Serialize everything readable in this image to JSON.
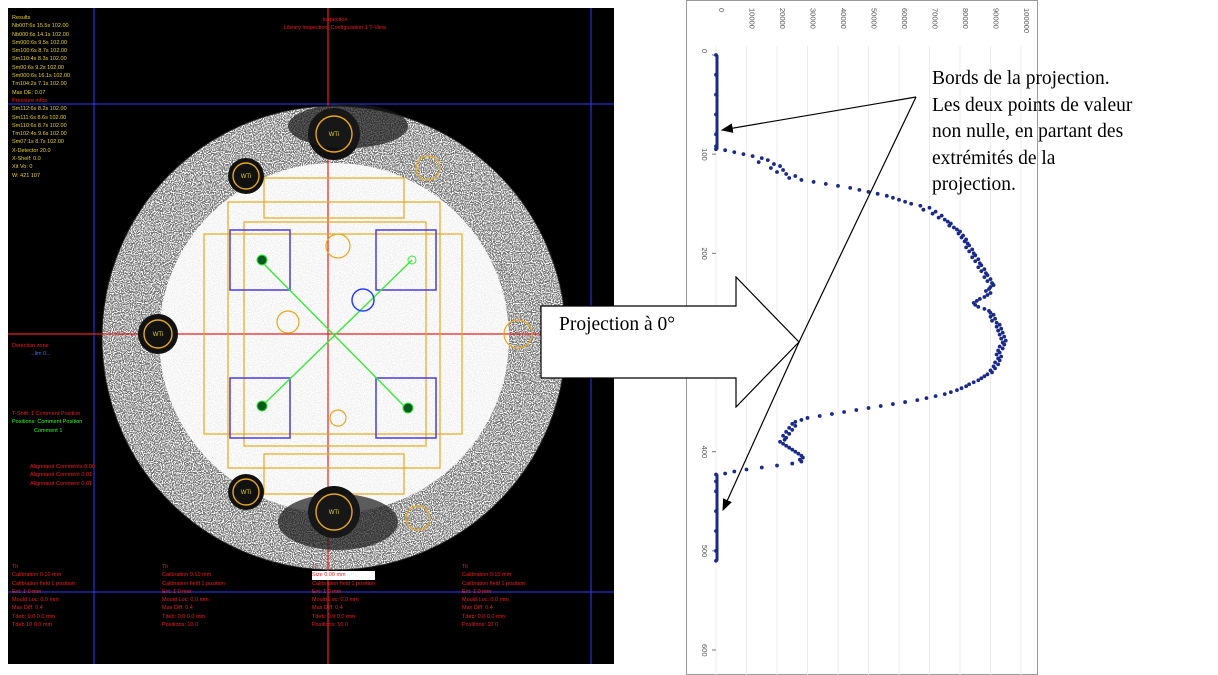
{
  "annotation": {
    "lines": [
      "Bords de la projection.",
      "Les deux points de valeur",
      "non nulle, en partant des",
      "extrémités de la",
      "projection."
    ]
  },
  "projection_label": "Projection à 0°",
  "xray": {
    "overlay_top_left": [
      "Results",
      "Nb00T:6s 15.5s 102.00",
      "Nb000:6s 14.1s 102.00",
      "Sm000:6s 9.5s 102.00",
      "Sm100:6s 8.7s 102.00",
      "Sm110:4s 8.3s 102.00",
      "Sm00:6s 9.2s 102.00",
      "Sm000:6s 16.1s 102.00",
      "Tm104:2s 7.1s 102.00",
      "Max DE: 0.07",
      "Pressure infos",
      "Sm112:6s 8.2s 102.00",
      "Sm111:6s 8.6s 102.00",
      "Sm110:6s 8.7s 102.00",
      "Tm102:4s 9.6s 102.00",
      "Sm07:1s 8.7s 102.00",
      "X-Detector 20.0",
      "X-Shelf: 0.0",
      "Xit Vo: 0",
      "W: 421 107"
    ],
    "overlay_top_center": [
      "Inspection",
      "Library Inspection_Configuration 1 T-View"
    ],
    "overlay_left_mid": [
      "Detection zone",
      "...lim 0..."
    ],
    "legend": [
      "T-Shift: 1 Comment Position",
      "Positions: Comment Position",
      "Comment 1"
    ],
    "status": [
      "Alignment Comments 0.00",
      "Alignment Comment 0.01",
      "Alignment Comment 0.01"
    ],
    "bottom_columns": [
      [
        "Tit",
        "Calibration 0.10 mm",
        "Calibration field 1 position",
        "Ext: 1 0 mm",
        "Mould Loc: 0.0 mm",
        "Max Diff: 0.4",
        "Tdeb: 0.0 0.0 mm",
        "Tdeb 10 0.0 mm"
      ],
      [
        "Tit",
        "Calibration 0.10 mm",
        "Calibration field 1 position",
        "Ext: 1 0 mm",
        "Mould Loc: 0.0 mm",
        "Max Diff: 0.4",
        "Tdeb: 0.0 0.0 mm",
        "Positions: 10 0"
      ],
      [
        "Tit",
        "Size 0.00 mm",
        "Calibration field 1 position",
        "Ext: 1 0 mm",
        "Mould Loc: 0.0 mm",
        "Max Diff: 0.4",
        "Tdeb: 0.0 0.0 mm",
        "Positions: 10 0"
      ],
      [
        "Tit",
        "Calibration 0.10 mm",
        "Calibration field 1 position",
        "Ext: 1 0 mm",
        "Mould Loc: 0.0 mm",
        "Max Diff: 0.4",
        "Tdeb: 0.0 0.0 mm",
        "Positions: 10 0"
      ]
    ],
    "disc_labels": [
      "WTi",
      "WTi",
      "WTi",
      "WTi",
      "WTi"
    ],
    "colors": {
      "ruler": "#e82020",
      "frame": "#2a3cff",
      "outline": "#e8a81c",
      "cross": "#38e838"
    }
  },
  "chart_data": {
    "type": "scatter",
    "orientation": "rotated-90",
    "x_ticks": [
      "0",
      "100",
      "200",
      "300",
      "400",
      "500",
      "600"
    ],
    "y_ticks": [
      "0",
      "10000",
      "20000",
      "30000",
      "40000",
      "50000",
      "60000",
      "70000",
      "80000",
      "90000",
      "100000"
    ],
    "xlim": [
      0,
      600
    ],
    "ylim": [
      0,
      100000
    ],
    "series": [
      {
        "color": "#1a2a8c",
        "points": [
          [
            0,
            0
          ],
          [
            20,
            0
          ],
          [
            40,
            0
          ],
          [
            60,
            0
          ],
          [
            80,
            0
          ],
          [
            92,
            0
          ],
          [
            95,
            0
          ],
          [
            96,
            3000
          ],
          [
            98,
            6000
          ],
          [
            100,
            9000
          ],
          [
            102,
            12000
          ],
          [
            104,
            15000
          ],
          [
            106,
            17000
          ],
          [
            108,
            14000
          ],
          [
            110,
            19000
          ],
          [
            112,
            21000
          ],
          [
            114,
            18000
          ],
          [
            116,
            22000
          ],
          [
            118,
            20000
          ],
          [
            120,
            23000
          ],
          [
            122,
            26000
          ],
          [
            124,
            24000
          ],
          [
            126,
            28000
          ],
          [
            128,
            32000
          ],
          [
            130,
            36000
          ],
          [
            132,
            40000
          ],
          [
            134,
            44000
          ],
          [
            136,
            47000
          ],
          [
            138,
            50000
          ],
          [
            140,
            53000
          ],
          [
            142,
            56000
          ],
          [
            144,
            58000
          ],
          [
            146,
            60000
          ],
          [
            148,
            62000
          ],
          [
            150,
            64000
          ],
          [
            152,
            67000
          ],
          [
            154,
            70000
          ],
          [
            156,
            68000
          ],
          [
            158,
            72000
          ],
          [
            160,
            71000
          ],
          [
            162,
            74000
          ],
          [
            164,
            73000
          ],
          [
            166,
            75000
          ],
          [
            168,
            76000
          ],
          [
            170,
            77000
          ],
          [
            172,
            76500
          ],
          [
            174,
            78000
          ],
          [
            176,
            79000
          ],
          [
            178,
            80000
          ],
          [
            180,
            79500
          ],
          [
            182,
            81000
          ],
          [
            184,
            80500
          ],
          [
            186,
            82000
          ],
          [
            188,
            81500
          ],
          [
            190,
            82500
          ],
          [
            192,
            83000
          ],
          [
            194,
            82000
          ],
          [
            196,
            84000
          ],
          [
            198,
            83000
          ],
          [
            200,
            84500
          ],
          [
            202,
            85000
          ],
          [
            204,
            84000
          ],
          [
            206,
            86000
          ],
          [
            208,
            85000
          ],
          [
            210,
            86500
          ],
          [
            212,
            87000
          ],
          [
            214,
            86000
          ],
          [
            216,
            88000
          ],
          [
            218,
            87000
          ],
          [
            220,
            88500
          ],
          [
            222,
            89000
          ],
          [
            224,
            88000
          ],
          [
            226,
            90000
          ],
          [
            228,
            89000
          ],
          [
            230,
            90500
          ],
          [
            232,
            91000
          ],
          [
            234,
            90000
          ],
          [
            236,
            89500
          ],
          [
            238,
            88500
          ],
          [
            240,
            90000
          ],
          [
            242,
            89000
          ],
          [
            244,
            88000
          ],
          [
            246,
            86500
          ],
          [
            248,
            85500
          ],
          [
            250,
            84500
          ],
          [
            252,
            85000
          ],
          [
            254,
            86000
          ],
          [
            256,
            88000
          ],
          [
            258,
            89500
          ],
          [
            260,
            90000
          ],
          [
            262,
            91000
          ],
          [
            264,
            90000
          ],
          [
            266,
            91500
          ],
          [
            268,
            90500
          ],
          [
            270,
            92000
          ],
          [
            272,
            93000
          ],
          [
            274,
            92000
          ],
          [
            276,
            93500
          ],
          [
            278,
            92500
          ],
          [
            280,
            94000
          ],
          [
            282,
            93000
          ],
          [
            284,
            94500
          ],
          [
            286,
            93500
          ],
          [
            288,
            95000
          ],
          [
            290,
            94000
          ],
          [
            292,
            94500
          ],
          [
            294,
            93000
          ],
          [
            296,
            94000
          ],
          [
            298,
            92500
          ],
          [
            300,
            93000
          ],
          [
            302,
            92000
          ],
          [
            304,
            93500
          ],
          [
            306,
            92500
          ],
          [
            308,
            93000
          ],
          [
            310,
            91500
          ],
          [
            312,
            92500
          ],
          [
            314,
            91000
          ],
          [
            316,
            91500
          ],
          [
            318,
            90000
          ],
          [
            320,
            90500
          ],
          [
            322,
            89000
          ],
          [
            324,
            88000
          ],
          [
            326,
            87000
          ],
          [
            328,
            86000
          ],
          [
            330,
            84500
          ],
          [
            332,
            83000
          ],
          [
            334,
            82000
          ],
          [
            336,
            80500
          ],
          [
            338,
            79000
          ],
          [
            340,
            77000
          ],
          [
            342,
            75000
          ],
          [
            344,
            72000
          ],
          [
            346,
            69000
          ],
          [
            348,
            66000
          ],
          [
            350,
            62000
          ],
          [
            352,
            58000
          ],
          [
            354,
            54000
          ],
          [
            356,
            50000
          ],
          [
            358,
            46000
          ],
          [
            360,
            42000
          ],
          [
            362,
            38000
          ],
          [
            364,
            34000
          ],
          [
            366,
            30000
          ],
          [
            368,
            28000
          ],
          [
            370,
            26000
          ],
          [
            372,
            25000
          ],
          [
            374,
            26000
          ],
          [
            376,
            24000
          ],
          [
            378,
            25000
          ],
          [
            380,
            23000
          ],
          [
            382,
            24000
          ],
          [
            384,
            22000
          ],
          [
            386,
            23000
          ],
          [
            388,
            22500
          ],
          [
            390,
            21000
          ],
          [
            392,
            22000
          ],
          [
            394,
            23000
          ],
          [
            396,
            24000
          ],
          [
            398,
            25000
          ],
          [
            400,
            26000
          ],
          [
            402,
            27000
          ],
          [
            404,
            28000
          ],
          [
            406,
            28500
          ],
          [
            408,
            27500
          ],
          [
            410,
            28000
          ],
          [
            412,
            25000
          ],
          [
            414,
            20000
          ],
          [
            416,
            15000
          ],
          [
            418,
            10000
          ],
          [
            420,
            6000
          ],
          [
            422,
            3000
          ],
          [
            423,
            0
          ],
          [
            430,
            0
          ],
          [
            440,
            0
          ],
          [
            460,
            0
          ],
          [
            480,
            0
          ],
          [
            500,
            0
          ],
          [
            510,
            0
          ]
        ]
      }
    ]
  }
}
